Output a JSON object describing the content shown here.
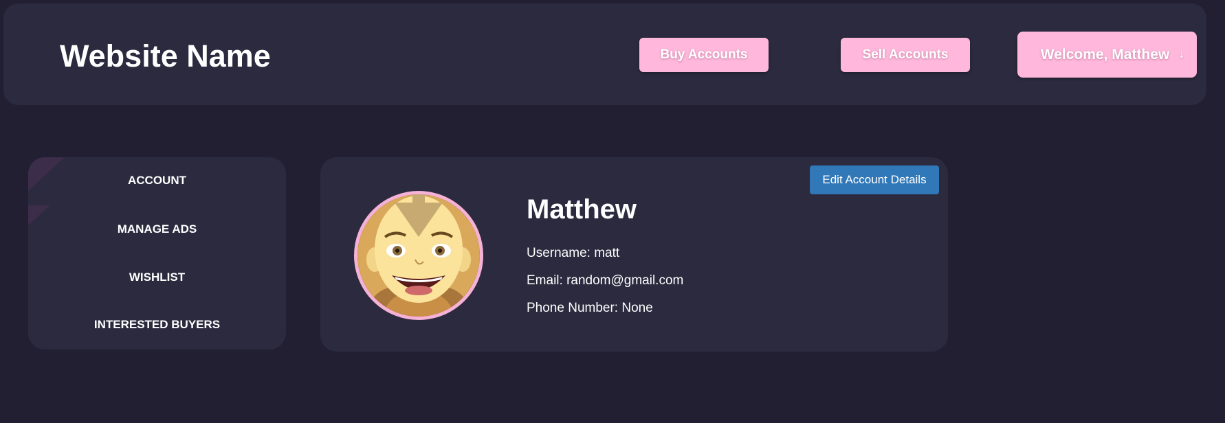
{
  "header": {
    "site_title": "Website Name",
    "buy_label": "Buy Accounts",
    "sell_label": "Sell Accounts",
    "welcome_label": "Welcome, Matthew",
    "welcome_icon": "arrow-down-icon"
  },
  "sidebar": {
    "items": [
      {
        "label": "ACCOUNT"
      },
      {
        "label": "MANAGE ADS"
      },
      {
        "label": "WISHLIST"
      },
      {
        "label": "INTERESTED BUYERS"
      }
    ]
  },
  "profile": {
    "edit_label": "Edit Account Details",
    "name": "Matthew",
    "username_line": "Username: matt",
    "email_line": "Email: random@gmail.com",
    "phone_line": "Phone Number: None",
    "avatar": "cartoon-avatar-image"
  },
  "colors": {
    "page_bg": "#211f31",
    "panel_bg": "#2b2a3f",
    "accent_pink": "#ffb8dc",
    "edit_blue": "#3178b8"
  }
}
